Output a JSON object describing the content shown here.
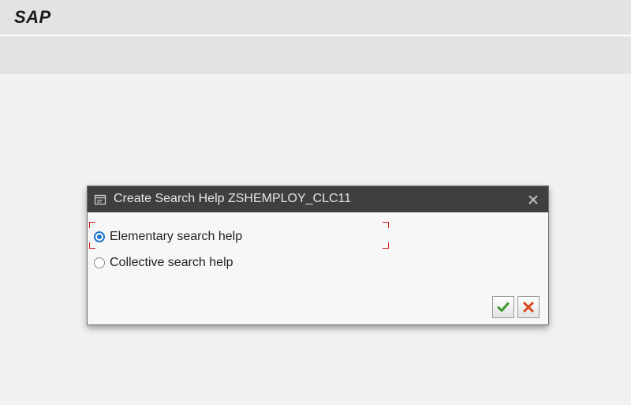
{
  "app": {
    "logo_text": "SAP"
  },
  "dialog": {
    "title": "Create Search Help ZSHEMPLOY_CLC11",
    "title_icon": "dialog-window-icon",
    "close_icon": "close-icon",
    "options": [
      {
        "label": "Elementary search help",
        "selected": true
      },
      {
        "label": "Collective search help",
        "selected": false
      }
    ],
    "buttons": {
      "continue_icon": "checkmark-icon",
      "continue_color": "#3a9a2a",
      "cancel_icon": "cancel-x-icon",
      "cancel_color": "#d84a1b"
    }
  },
  "colors": {
    "dialog_header": "#3f3f3f",
    "radio_selected": "#1f73c8",
    "focus_frame": "#d21a1a"
  }
}
